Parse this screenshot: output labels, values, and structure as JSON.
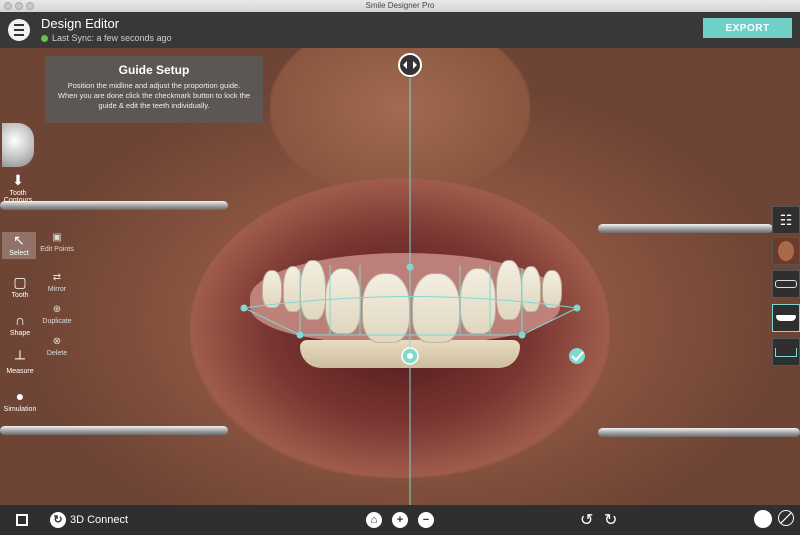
{
  "window": {
    "title": "Smile Designer Pro"
  },
  "header": {
    "title": "Design Editor",
    "sync_text": "Last Sync: a few seconds ago",
    "export_label": "EXPORT"
  },
  "guide": {
    "title": "Guide Setup",
    "text": "Position the midline and adjust the proportion guide.  When you are done click the checkmark button to lock the guide & edit the teeth individually."
  },
  "toolbar": {
    "tooth_contours": "Tooth Contours",
    "select": "Select",
    "tooth": "Tooth",
    "shape": "Shape",
    "measure": "Measure",
    "simulation": "Simulation"
  },
  "subtools": {
    "edit_points": "Edit Points",
    "mirror": "Mirror",
    "duplicate": "Duplicate",
    "delete": "Delete"
  },
  "bottom": {
    "connect_label": "3D Connect"
  },
  "colors": {
    "accent": "#6fd0c8",
    "guide_line": "#7fd8d2",
    "header_bg": "#383838",
    "sync_ok": "#6cc04a"
  }
}
